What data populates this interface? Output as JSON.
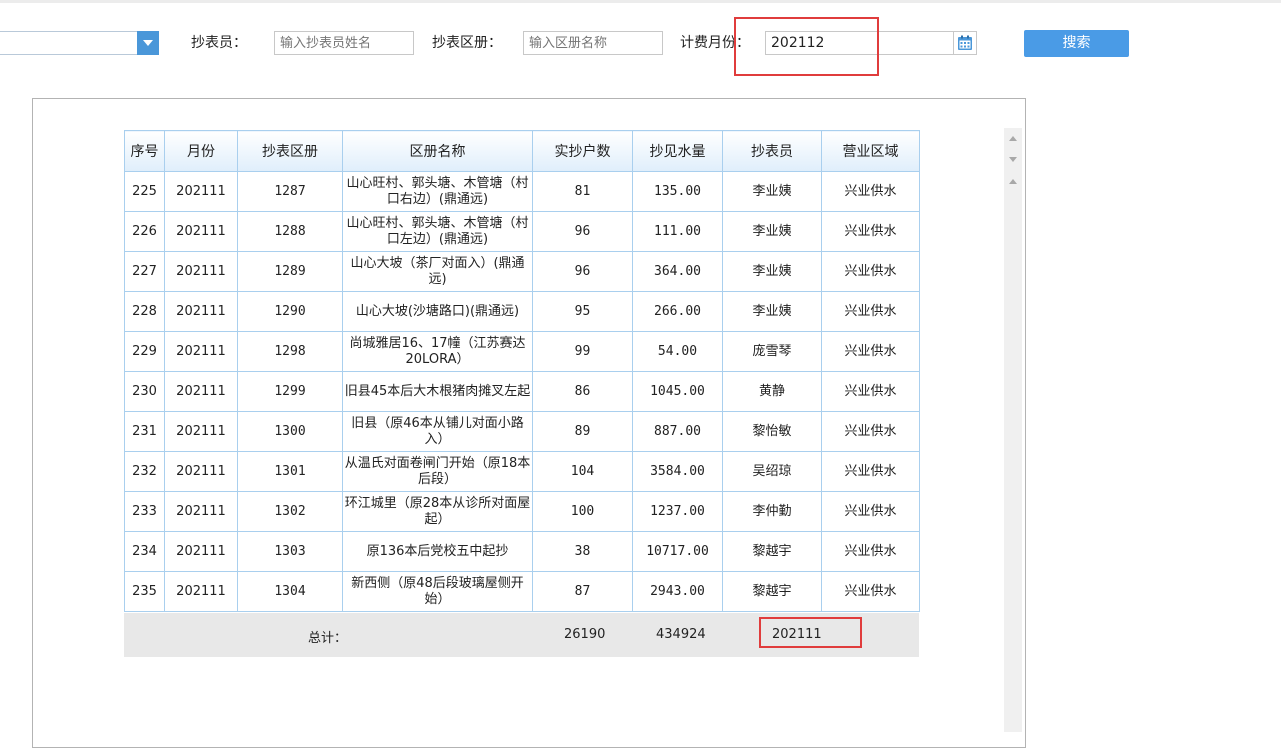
{
  "filters": {
    "reader_label": "抄表员：",
    "reader_placeholder": "输入抄表员姓名",
    "district_label": "抄表区册：",
    "district_placeholder": "输入区册名称",
    "month_label": "计费月份：",
    "month_value": "202112",
    "search_label": "搜索"
  },
  "table": {
    "columns": [
      "序号",
      "月份",
      "抄表区册",
      "区册名称",
      "实抄户数",
      "抄见水量",
      "抄表员",
      "营业区域"
    ],
    "rows": [
      [
        "225",
        "202111",
        "1287",
        "山心旺村、郭头塘、木管塘（村口右边）(鼎通远)",
        "81",
        "135.00",
        "李业姨",
        "兴业供水"
      ],
      [
        "226",
        "202111",
        "1288",
        "山心旺村、郭头塘、木管塘（村口左边）(鼎通远)",
        "96",
        "111.00",
        "李业姨",
        "兴业供水"
      ],
      [
        "227",
        "202111",
        "1289",
        "山心大坡（茶厂对面入）(鼎通远)",
        "96",
        "364.00",
        "李业姨",
        "兴业供水"
      ],
      [
        "228",
        "202111",
        "1290",
        "山心大坡(沙塘路口)(鼎通远)",
        "95",
        "266.00",
        "李业姨",
        "兴业供水"
      ],
      [
        "229",
        "202111",
        "1298",
        "尚城雅居16、17幢（江苏赛达20LORA）",
        "99",
        "54.00",
        "庞雪琴",
        "兴业供水"
      ],
      [
        "230",
        "202111",
        "1299",
        "旧县45本后大木根猪肉摊叉左起",
        "86",
        "1045.00",
        "黄静",
        "兴业供水"
      ],
      [
        "231",
        "202111",
        "1300",
        "旧县（原46本从铺儿对面小路入）",
        "89",
        "887.00",
        "黎怡敏",
        "兴业供水"
      ],
      [
        "232",
        "202111",
        "1301",
        "从温氏对面卷闸门开始（原18本后段）",
        "104",
        "3584.00",
        "吴绍琼",
        "兴业供水"
      ],
      [
        "233",
        "202111",
        "1302",
        "环江城里（原28本从诊所对面屋起）",
        "100",
        "1237.00",
        "李仲勤",
        "兴业供水"
      ],
      [
        "234",
        "202111",
        "1303",
        "原136本后党校五中起抄",
        "38",
        "10717.00",
        "黎越宇",
        "兴业供水"
      ],
      [
        "235",
        "202111",
        "1304",
        "新西侧（原48后段玻璃屋侧开始）",
        "87",
        "2943.00",
        "黎越宇",
        "兴业供水"
      ]
    ]
  },
  "totals": {
    "label": "总计：",
    "households": "26190",
    "volume": "434924",
    "month": "202111"
  },
  "icons": {
    "dropdown": "chevron-down-icon",
    "calendar": "calendar-icon"
  },
  "colors": {
    "accent": "#4a9be6",
    "highlight": "#e03c3c",
    "table_border": "#a9cfee"
  }
}
